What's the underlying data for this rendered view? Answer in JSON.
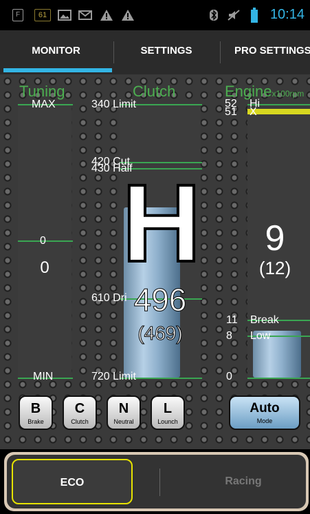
{
  "status_bar": {
    "icons": [
      "sim-card-icon",
      "notification-61-icon",
      "image-icon",
      "mail-icon",
      "warning-icon",
      "warning-icon",
      "bluetooth-icon",
      "mute-icon",
      "battery-icon"
    ],
    "notification_number": "61",
    "time": "10:14",
    "accent": "#33b5e5"
  },
  "tabs": [
    {
      "label": "MONITOR",
      "active": true
    },
    {
      "label": "SETTINGS",
      "active": false
    },
    {
      "label": "PRO SETTINGS",
      "active": false
    }
  ],
  "tuning": {
    "title": "Tuning",
    "max_label": "MAX",
    "zero_label": "0",
    "value": "0",
    "min_label": "MIN"
  },
  "clutch": {
    "title": "Clutch",
    "top_limit": "340 Limit",
    "cut": "420 Cut",
    "half": "430 Half",
    "drive": "610 Dri",
    "bottom_limit": "720 Limit",
    "gear": "H",
    "value": "496",
    "sub_value": "(469)",
    "fill_level": 0.62
  },
  "engine": {
    "title": "Engine",
    "unit": "x100rpm",
    "hi_value": "52",
    "hi_label": "Hi",
    "x_value": "51",
    "x_label": "X",
    "value": "9",
    "sub_value": "(12)",
    "break_value": "11",
    "break_label": "Break",
    "low_value": "8",
    "low_label": "Low",
    "zero": "0",
    "fill_level": 0.17,
    "x_color": "#d8d820"
  },
  "toggles": [
    {
      "key": "B",
      "label": "Brake"
    },
    {
      "key": "C",
      "label": "Clutch"
    },
    {
      "key": "N",
      "label": "Neutral"
    },
    {
      "key": "L",
      "label": "Lounch"
    }
  ],
  "auto": {
    "key": "Auto",
    "label": "Mode",
    "color": "#8fbde0"
  },
  "modes": [
    {
      "label": "ECO",
      "selected": true
    },
    {
      "label": "Racing",
      "selected": false
    }
  ],
  "colors": {
    "gauge_line": "#3aa652",
    "selected_border": "#e6e200"
  }
}
